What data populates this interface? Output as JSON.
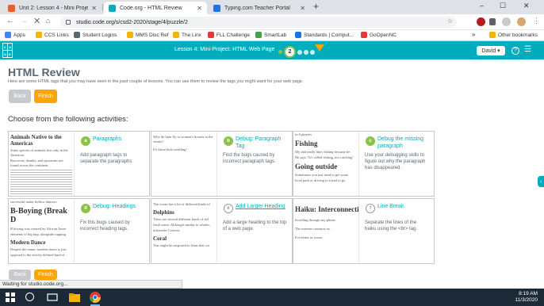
{
  "browser": {
    "tabs": [
      {
        "title": "Unit 2: Lesson 4 - Mini Project: H",
        "favicon_color": "#e3622b",
        "active": false
      },
      {
        "title": "Code.org - HTML Review",
        "favicon_color": "#00adbc",
        "active": true
      },
      {
        "title": "Typing.com Teacher Portal",
        "favicon_color": "#1a73e8",
        "active": false
      }
    ],
    "new_tab": "+",
    "window_controls": [
      "–",
      "☐",
      "✕"
    ],
    "address": "studio.code.org/s/csd2-2020/stage/4/puzzle/2",
    "bookmarks": [
      {
        "label": "Apps",
        "color": "#4285f4"
      },
      {
        "label": "CCS Links",
        "color": "#f4b400"
      },
      {
        "label": "Student Logins",
        "color": "#5b6770"
      },
      {
        "label": "MMS Disc Ref",
        "color": "#f4b400"
      },
      {
        "label": "The Linx",
        "color": "#f4b400"
      },
      {
        "label": "FLL Challenge",
        "color": "#e53935"
      },
      {
        "label": "SmartLab",
        "color": "#43a047"
      },
      {
        "label": "Standards | Comput...",
        "color": "#1a73e8"
      },
      {
        "label": "GoOpenNC",
        "color": "#e53935"
      },
      {
        "label": "Other bookmarks",
        "color": "#f4b400"
      }
    ],
    "bookmarks_more": "»"
  },
  "codeorg": {
    "logo_letters": [
      "C",
      "O",
      "D",
      "E"
    ],
    "lesson_title": "Lesson 4: Mini-Project: HTML Web Page",
    "current_level": "2",
    "user_name": "David"
  },
  "page": {
    "title": "HTML Review",
    "description": "Here are some HTML tags that you may have seen in the past couple of lessons. You can use them to review the tags you might want for your web page.",
    "back_label": "Back",
    "finish_label": "Finish",
    "choose_heading": "Choose from the following activities:"
  },
  "activities": [
    {
      "badge": "a",
      "title": "Paragraphs",
      "desc": "Add paragraph tags to separate the paragraphs",
      "badge_style": "green",
      "thumb": {
        "heading": "Animals Native to the Americas",
        "text": [
          "Some species of animals live only in the Americas.",
          "Raccoons, skunks, and opossums are found across the continent."
        ]
      }
    },
    {
      "badge": "b",
      "title": "Debug: Paragraph Tag",
      "desc": "Find the bugs caused by incorrect paragraph tags.",
      "badge_style": "green",
      "thumb": {
        "heading": "",
        "text": [
          "Why do hula fly to women's houses in the winter?",
          "It's those hula wedding!"
        ]
      }
    },
    {
      "badge": "c",
      "title": "Debug the missing paragraph",
      "desc": "Use your debugging skills to figure out why the paragraph has disappeared.",
      "badge_style": "green",
      "thumb": {
        "heading": "Fishing",
        "heading2": "Going outside",
        "text": [
          "to 6 players",
          "My dad really likes fishing because he",
          "He says \"It's called fishing, not catching\"",
          "Sometimes you just need to get some",
          "local park or driving to a trail to go"
        ]
      }
    },
    {
      "badge": "d",
      "title": "Debug: Headings",
      "desc": "Fix this bugs caused by incorrect heading tags.",
      "badge_style": "green",
      "thumb": {
        "heading": "B-Boying (Break D",
        "heading2": "Modern Dance",
        "text": [
          "successful under hollow dancers.",
          "B boying was created by African Amer",
          "elements of hip hop, alongside rapping",
          "Despite the name, modern dance is just",
          "opposed to the strictly defined kind of"
        ]
      }
    },
    {
      "badge": "e",
      "title": "Add Larger Heading",
      "desc": "Add a large heading to the top of a web page.",
      "badge_style": "empty",
      "thumb": {
        "heading": "Dolphins",
        "heading2": "Coral",
        "text": [
          "The ocean has a lot of different kinds of",
          "There are several different kinds of dol",
          "fresh water. Although similar to whales,",
          "infraorder Cetacea",
          "You might be surprised to learn that cor"
        ]
      }
    },
    {
      "badge": "f",
      "title": "Line Break",
      "desc": "Separate the lines of the haiku using the <br> tag.",
      "badge_style": "empty",
      "thumb": {
        "heading": "Haiku: Interconnection",
        "text": [
          "Scrolling through my phone.",
          "The internet connects us.",
          "For better or worse."
        ]
      }
    }
  ],
  "bottom_back_label": "Back",
  "bottom_finish_label": "Finish",
  "status": "Waiting for studio.code.org...",
  "clock": {
    "time": "8:19 AM",
    "date": "11/3/2020"
  },
  "colors": {
    "accent": "#00adbc",
    "finish": "#ffa400",
    "green": "#8bc34a"
  }
}
